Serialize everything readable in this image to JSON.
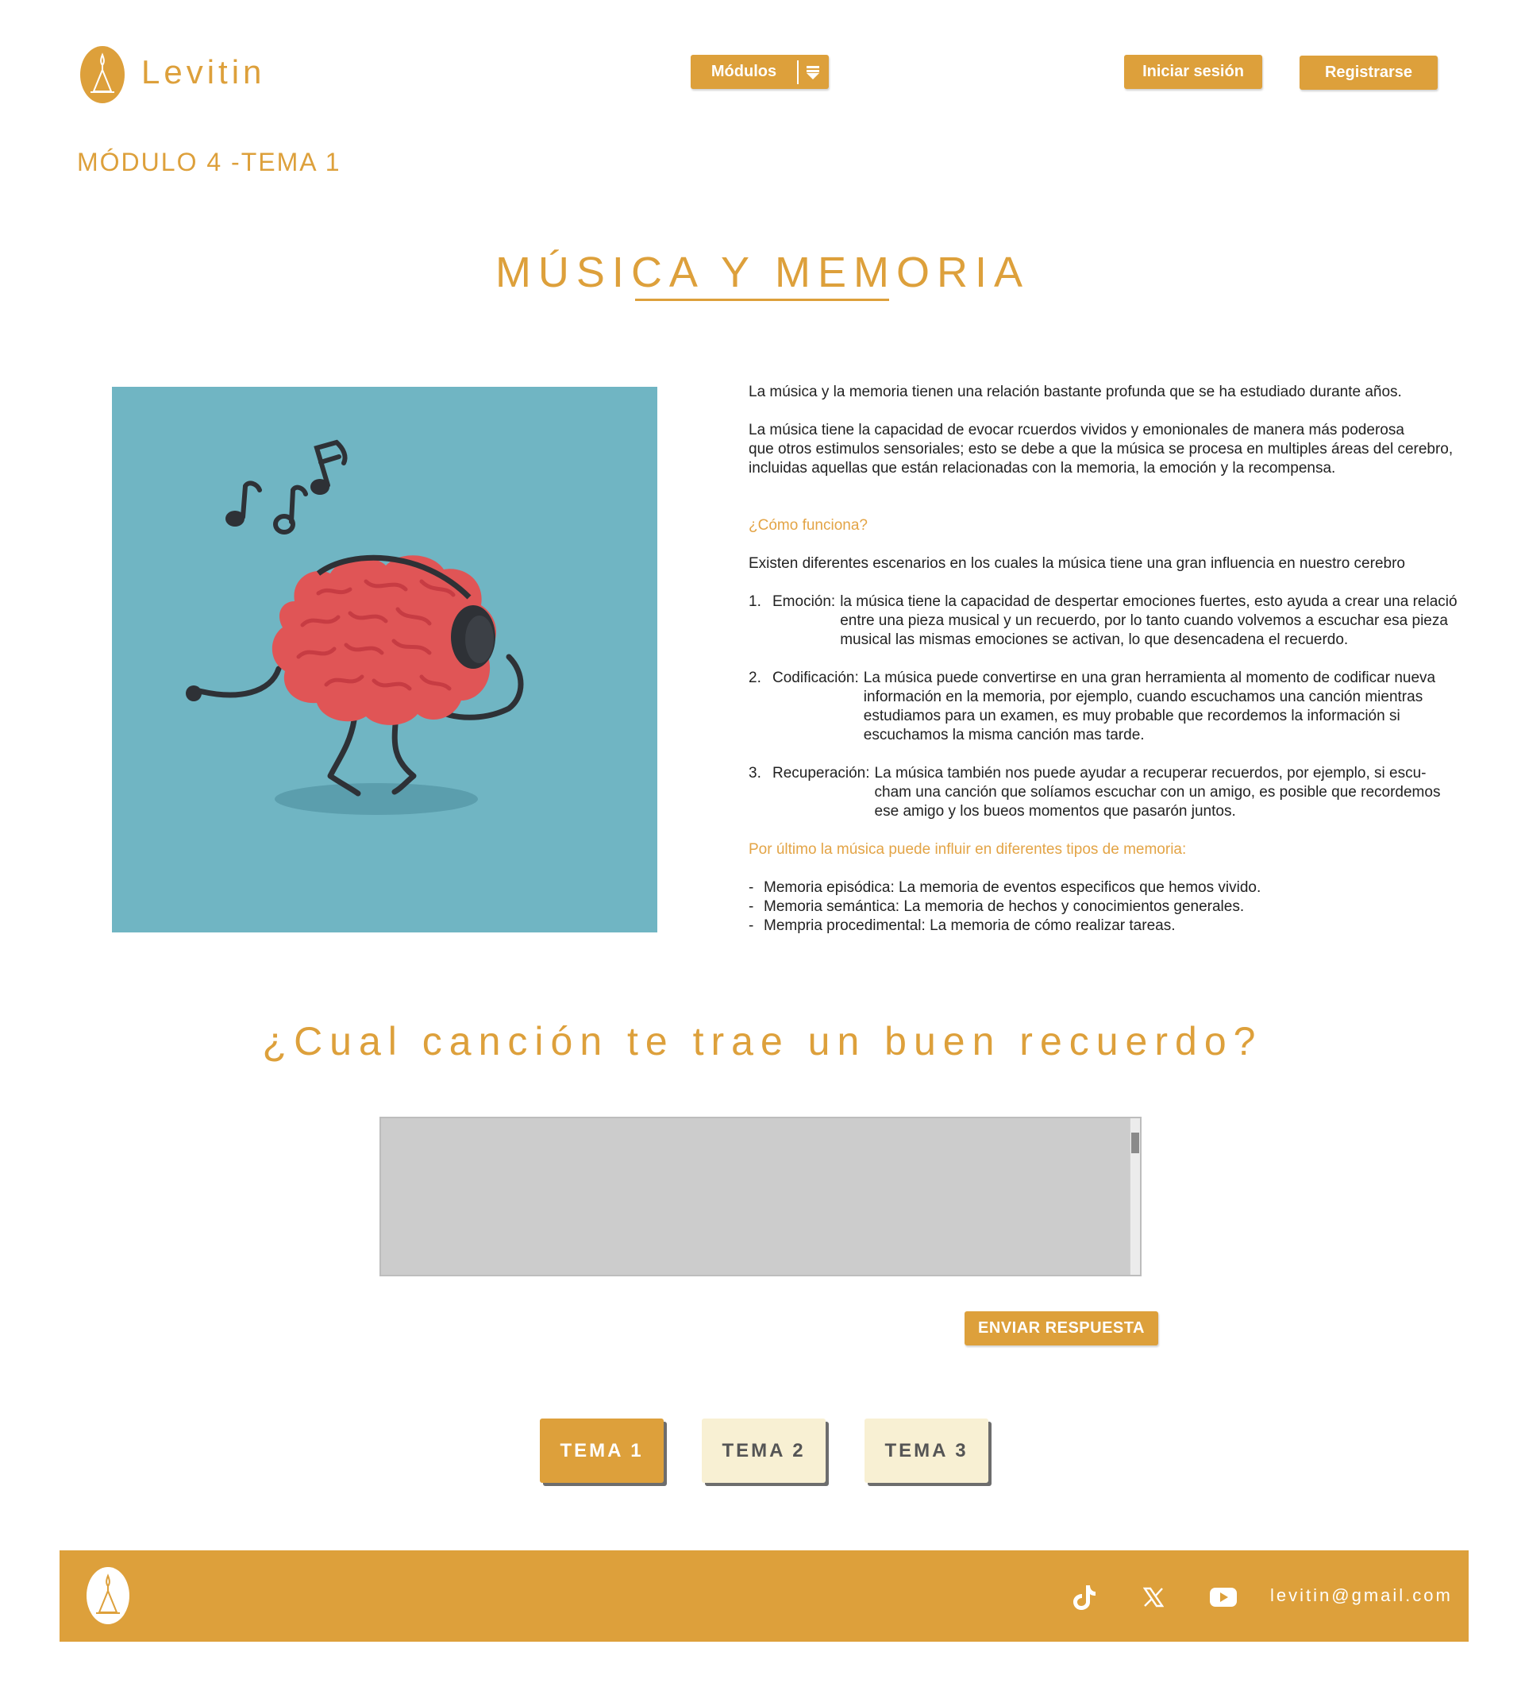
{
  "header": {
    "brand": "Levitin",
    "modules_label": "Módulos",
    "login_label": "Iniciar sesión",
    "register_label": "Registrarse"
  },
  "module_label": "MÓDULO 4 -TEMA 1",
  "title": "MÚSICA Y MEMORIA",
  "article": {
    "intro": "La música y la memoria tienen una relación bastante profunda que se ha estudiado durante años.",
    "para2": [
      "La música tiene la capacidad de evocar rcuerdos vividos y emonionales de manera más poderosa",
      "que otros estimulos sensoriales; esto se debe a que la música se procesa en multiples áreas del cerebro,",
      "incluidas aquellas que están relacionadas con la memoria, la emoción y la recompensa."
    ],
    "how_heading": "¿Cómo funciona?",
    "scenarios_intro": "Existen diferentes escenarios en los cuales la música tiene una gran influencia en nuestro cerebro",
    "items": [
      {
        "num": "1.",
        "term": "Emoción:",
        "lines": [
          "la música tiene la capacidad de despertar emociones fuertes, esto ayuda a crear una relació",
          "entre una pieza musical y un recuerdo, por lo tanto cuando volvemos a escuchar esa pieza",
          "musical las mismas emociones se activan, lo que desencadena el recuerdo."
        ]
      },
      {
        "num": "2.",
        "term": "Codificación:",
        "lines": [
          "La música puede convertirse en una gran herramienta al momento de codificar nueva",
          "información en la memoria, por ejemplo, cuando  escuchamos una canción mientras",
          "estudiamos para un examen, es muy probable que recordemos la información si",
          "escuchamos la misma canción mas tarde."
        ]
      },
      {
        "num": "3.",
        "term": "Recuperación:",
        "lines": [
          "La música también nos puede ayudar a recuperar recuerdos, por ejemplo, si escu-",
          "cham una canción que solíamos escuchar con un amigo, es posible que recordemos",
          "ese amigo y los bueos momentos que pasarón juntos."
        ]
      }
    ],
    "closing_heading": "Por último la música puede influir en diferentes tipos de memoria:",
    "memory_types": [
      "Memoria episódica: La memoria de eventos especificos que hemos vivido.",
      "Memoria semántica: La memoria de hechos y conocimientos generales.",
      "Mempria procedimental: La memoria de cómo realizar tareas."
    ]
  },
  "question": "¿Cual canción te trae un buen recuerdo?",
  "answer": {
    "value": ""
  },
  "send_label": "ENVIAR RESPUESTA",
  "topics": [
    {
      "label": "TEMA 1",
      "active": true
    },
    {
      "label": "TEMA 2",
      "active": false
    },
    {
      "label": "TEMA 3",
      "active": false
    }
  ],
  "footer": {
    "email": "levitin@gmail.com",
    "social": [
      "tiktok-icon",
      "x-icon",
      "youtube-icon"
    ]
  },
  "colors": {
    "accent": "#DDA03B",
    "illustration_bg": "#70B5C3",
    "brain": "#E05556",
    "topic_inactive": "#F8F0D3"
  }
}
